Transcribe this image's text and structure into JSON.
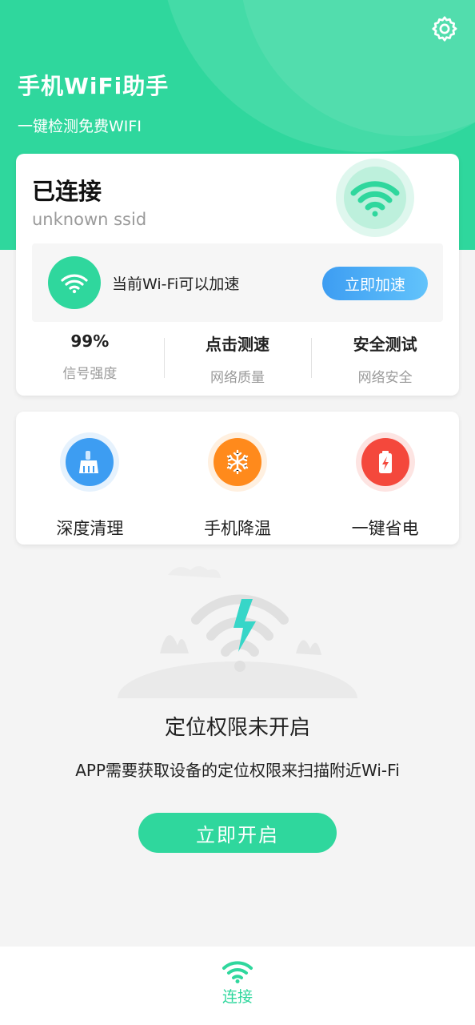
{
  "header": {
    "title": "手机WiFi助手",
    "subtitle": "一键检测免费WIFI",
    "settings_icon": "gear-icon"
  },
  "connection": {
    "status": "已连接",
    "ssid": "unknown ssid",
    "wifi_icon": "wifi-icon"
  },
  "accelerate": {
    "text": "当前Wi-Fi可以加速",
    "button": "立即加速"
  },
  "stats": [
    {
      "value": "99%",
      "label": "信号强度"
    },
    {
      "value": "点击测速",
      "label": "网络质量"
    },
    {
      "value": "安全测试",
      "label": "网络安全"
    }
  ],
  "tools": [
    {
      "label": "深度清理",
      "icon": "broom-icon",
      "color": "#3d9df2"
    },
    {
      "label": "手机降温",
      "icon": "snowflake-icon",
      "color": "#ff8a1c"
    },
    {
      "label": "一键省电",
      "icon": "battery-icon",
      "color": "#f4483c"
    }
  ],
  "permission": {
    "title": "定位权限未开启",
    "description": "APP需要获取设备的定位权限来扫描附近Wi-Fi",
    "button": "立即开启"
  },
  "tabbar": {
    "items": [
      {
        "label": "连接",
        "icon": "wifi-icon"
      }
    ]
  },
  "colors": {
    "primary": "#2fd79d",
    "accent_blue": "#3d9df2",
    "background": "#f4f4f4"
  }
}
